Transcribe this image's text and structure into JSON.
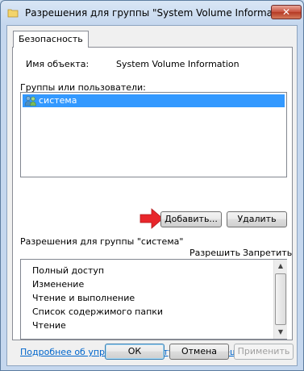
{
  "window": {
    "title": "Разрешения для группы \"System Volume Information\"",
    "close_label": "✕"
  },
  "tabs": [
    {
      "label": "Безопасность"
    }
  ],
  "object": {
    "label": "Имя объекта:",
    "value": "System Volume Information"
  },
  "groups": {
    "label": "Группы или пользователи:",
    "items": [
      {
        "name": "система",
        "selected": true
      }
    ]
  },
  "buttons": {
    "add": "Добавить...",
    "remove": "Удалить"
  },
  "permissions": {
    "label": "Разрешения для группы \"система\"",
    "col_allow": "Разрешить",
    "col_deny": "Запретить",
    "rows": [
      "Полный доступ",
      "Изменение",
      "Чтение и выполнение",
      "Список содержимого папки",
      "Чтение"
    ]
  },
  "help_link": "Подробнее об управлении доступом и разрешениях",
  "footer": {
    "ok": "ОК",
    "cancel": "Отмена",
    "apply": "Применить"
  },
  "colors": {
    "selection": "#3399ff",
    "link": "#0066cc",
    "arrow": "#e8262b"
  }
}
